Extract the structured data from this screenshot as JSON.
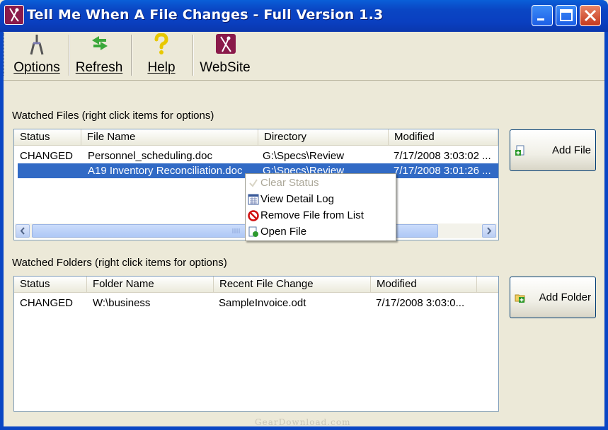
{
  "window": {
    "title": "Tell Me When A File Changes - Full Version 1.3",
    "controls": [
      "minimize",
      "maximize",
      "close"
    ]
  },
  "toolbar": {
    "buttons": [
      {
        "label": "Options",
        "icon": "options-icon"
      },
      {
        "label": "Refresh",
        "icon": "refresh-icon"
      },
      {
        "label": "Help",
        "icon": "help-icon"
      },
      {
        "label": "WebSite",
        "icon": "website-icon"
      }
    ]
  },
  "files": {
    "section_label": "Watched Files (right click items for options)",
    "columns": [
      "Status",
      "File Name",
      "Directory",
      "Modified"
    ],
    "rows": [
      {
        "status": "CHANGED",
        "name": "Personnel_scheduling.doc",
        "directory": "G:\\Specs\\Review",
        "modified": "7/17/2008 3:03:02 ...",
        "selected": false
      },
      {
        "status": "",
        "name": "A19 Inventory Reconciliation.doc",
        "directory": "G:\\Specs\\Review",
        "modified": "7/17/2008 3:01:26 ...",
        "selected": true
      }
    ],
    "add_button": "Add File"
  },
  "context_menu": {
    "items": [
      {
        "label": "Clear Status",
        "icon": "clear-status-icon",
        "enabled": false
      },
      {
        "label": "View Detail Log",
        "icon": "log-icon",
        "enabled": true
      },
      {
        "label": "Remove File from List",
        "icon": "remove-icon",
        "enabled": true
      },
      {
        "label": "Open File",
        "icon": "open-file-icon",
        "enabled": true
      }
    ]
  },
  "folders": {
    "section_label": "Watched Folders (right click items for options)",
    "columns": [
      "Status",
      "Folder Name",
      "Recent File Change",
      "Modified"
    ],
    "rows": [
      {
        "status": "CHANGED",
        "name": "W:\\business",
        "recent": "SampleInvoice.odt",
        "modified": "7/17/2008 3:03:0..."
      }
    ],
    "add_button": "Add Folder"
  },
  "watermark": "GearDownload.com",
  "colors": {
    "titlebar": "#0a46c4",
    "selection": "#316ac5",
    "face": "#ece9d8"
  }
}
